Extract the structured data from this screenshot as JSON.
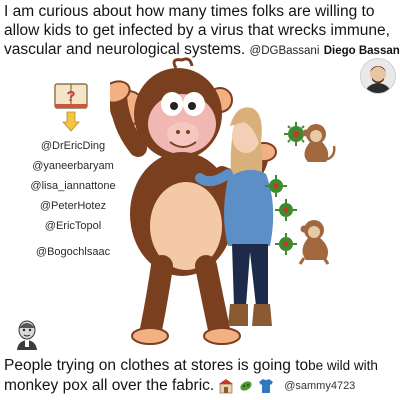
{
  "headline": {
    "text_line1": "I am curious about how many times folks are willing to",
    "text_line2": "allow kids to get infected by a virus that wrecks immune,",
    "text_line3": "vascular and neurological systems.",
    "handle": "@DGBassani",
    "author": "Diego Bassani,"
  },
  "mentions": [
    "@DrEricDing",
    "@yaneerbaryam",
    "@lisa_iannattone",
    "@PeterHotez",
    "@EricTopol",
    "@Bogochlsaac"
  ],
  "caption": {
    "line1_main": "People trying on clothes at stores is going to",
    "line1_tail": "be wild with",
    "line2": "monkey pox all over the fabric.",
    "handle": "@sammy4723"
  },
  "icons": {
    "book": "question-book-icon",
    "pointer": "pointing-hand-icon",
    "virus": "virus-icon",
    "monkey": "monkey-icon",
    "store": "store-icon",
    "microbe": "microbe-icon",
    "shirt": "shirt-icon"
  },
  "colors": {
    "monkey_brown": "#7a3f1f",
    "monkey_face": "#f1b7b2",
    "virus_green": "#3f8a2c",
    "shirt_blue": "#5b8fc5",
    "jeans": "#1d2a4a"
  }
}
